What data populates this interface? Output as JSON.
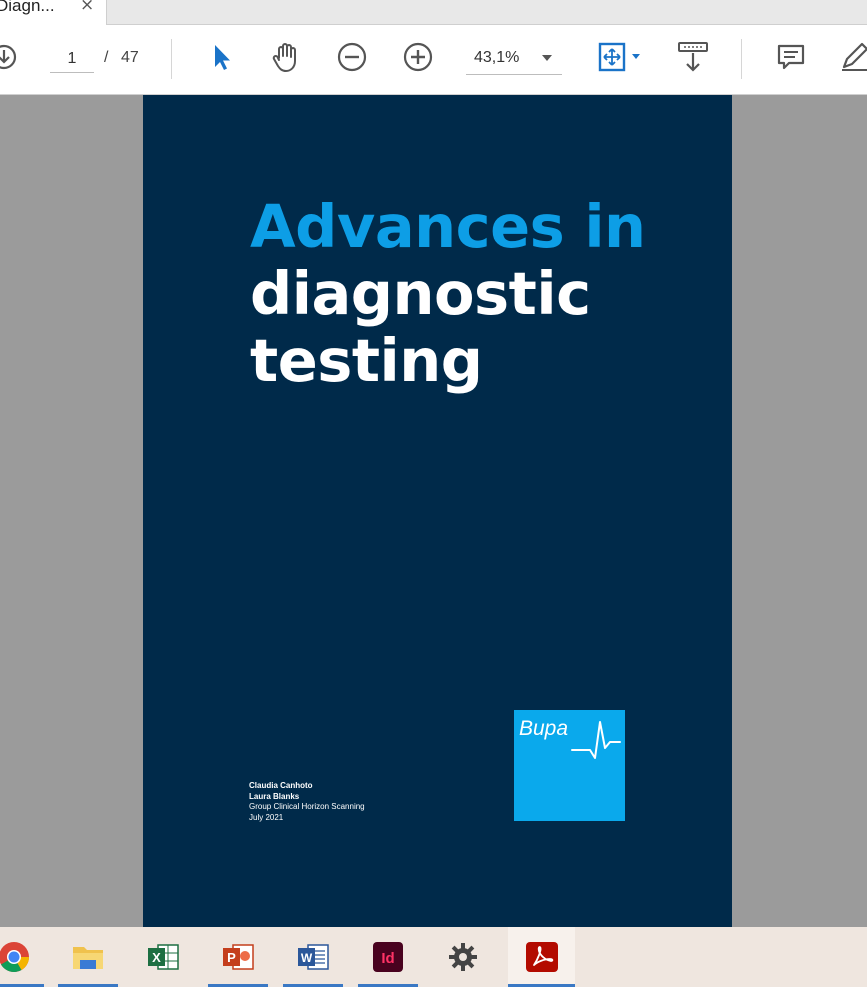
{
  "tab": {
    "title": "Diagn...",
    "close_glyph": "×"
  },
  "toolbar": {
    "page_current": "1",
    "page_separator": "/",
    "page_total": "47",
    "zoom": "43,1%",
    "icons": [
      "download-icon",
      "select-pointer-icon",
      "hand-tool-icon",
      "zoom-out-icon",
      "zoom-in-icon",
      "fit-page-icon",
      "scroll-mode-icon",
      "comment-icon",
      "pen-icon"
    ]
  },
  "document": {
    "title_line1": "Advances in",
    "title_line2": "diagnostic",
    "title_line3": "testing",
    "author1": "Claudia Canhoto",
    "author2": "Laura Blanks",
    "department": "Group Clinical Horizon Scanning",
    "date": "July 2021",
    "logo_text": "Bupa",
    "colors": {
      "page_bg": "#002a4a",
      "title_accent": "#0d9ee6",
      "logo_bg": "#0aa9ec"
    }
  },
  "taskbar": {
    "apps": [
      {
        "name": "chrome-icon"
      },
      {
        "name": "file-explorer-icon"
      },
      {
        "name": "excel-icon",
        "letter": "X"
      },
      {
        "name": "powerpoint-icon",
        "letter": "P"
      },
      {
        "name": "word-icon",
        "letter": "W"
      },
      {
        "name": "indesign-icon",
        "letter": "Id"
      },
      {
        "name": "settings-icon"
      },
      {
        "name": "acrobat-icon"
      }
    ]
  }
}
